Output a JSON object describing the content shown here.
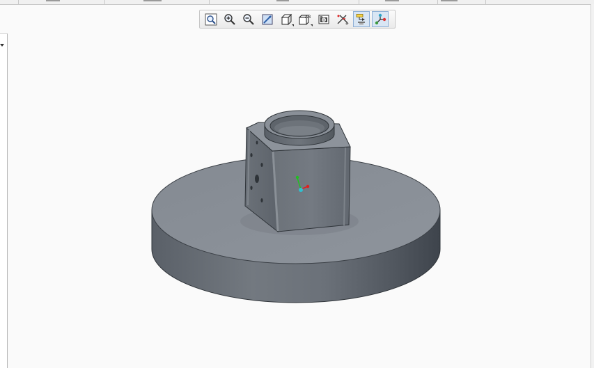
{
  "toolbar": {
    "buttons": [
      {
        "icon": "refit-icon",
        "active": false
      },
      {
        "icon": "zoom-in-icon",
        "active": false
      },
      {
        "icon": "zoom-out-icon",
        "active": false
      },
      {
        "icon": "repaint-icon",
        "active": false
      },
      {
        "icon": "display-style-icon",
        "active": false
      },
      {
        "icon": "saved-orientations-icon",
        "active": false
      },
      {
        "icon": "view-manager-icon",
        "active": false
      },
      {
        "icon": "datum-display-filters-icon",
        "active": false
      },
      {
        "icon": "annotation-display-icon",
        "active": true
      },
      {
        "icon": "spin-center-icon",
        "active": true
      }
    ],
    "saved_views_glyph": "AB"
  },
  "colors": {
    "background": "#fafafa",
    "model_top": "#8a9098",
    "model_side": "#5f656d",
    "accent_active": "#d9e6f4",
    "csys_x": "#e02020",
    "csys_y": "#20c020",
    "csys_origin": "#30c0d0"
  }
}
